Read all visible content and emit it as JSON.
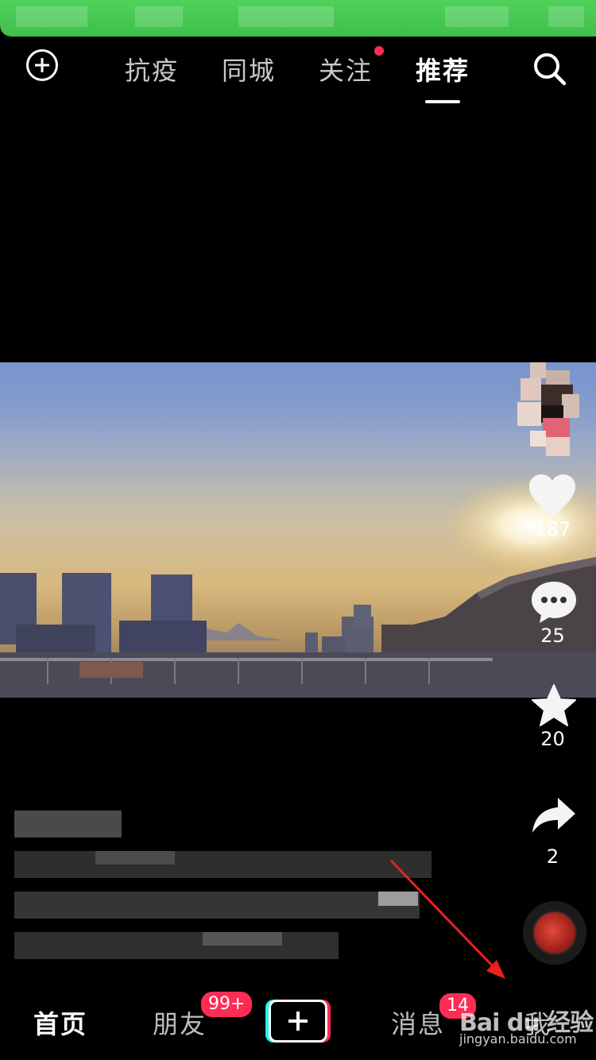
{
  "top_tabs": [
    {
      "label": "抗疫",
      "active": false
    },
    {
      "label": "同城",
      "active": false
    },
    {
      "label": "关注",
      "active": false,
      "has_dot": true
    },
    {
      "label": "推荐",
      "active": true
    }
  ],
  "actions": {
    "like_count": "187",
    "comment_count": "25",
    "favorite_count": "20",
    "share_count": "2"
  },
  "bottom_nav": {
    "home_label": "首页",
    "friends_label": "朋友",
    "friends_badge": "99+",
    "messages_label": "消息",
    "messages_badge": "14",
    "me_label": "我"
  },
  "watermark": {
    "brand": "Bai du 经验",
    "url": "jingyan.baidu.com"
  },
  "colors": {
    "status_bar": "#4fd15a",
    "accent_red": "#fe2c55",
    "accent_cyan": "#25f4ee",
    "annotation_arrow": "#e8231c"
  },
  "icons": [
    "add-circle-icon",
    "search-icon",
    "heart-icon",
    "comment-icon",
    "star-icon",
    "share-icon",
    "music-disc-icon",
    "create-plus-icon"
  ]
}
